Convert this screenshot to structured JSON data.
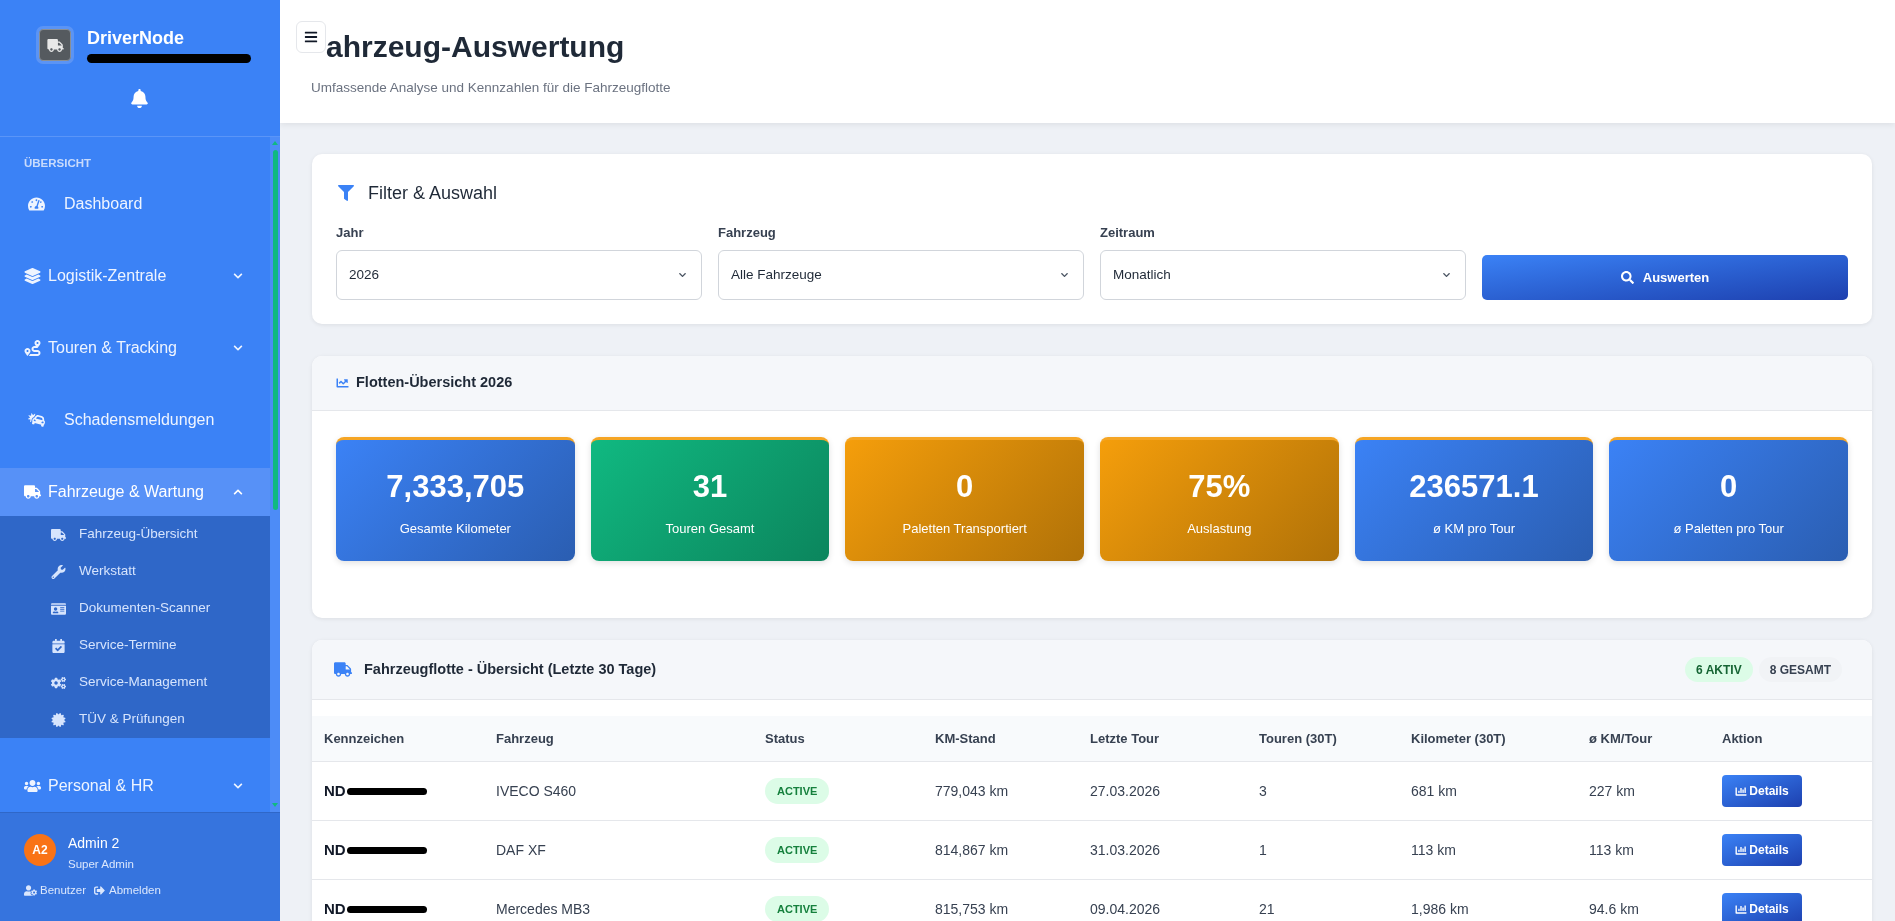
{
  "sidebar": {
    "brand": {
      "name": "DriverNode",
      "redacted": true
    },
    "section_label": "ÜBERSICHT",
    "items": [
      {
        "label": "Dashboard",
        "kind": "link",
        "selected": false
      },
      {
        "label": "Logistik-Zentrale",
        "kind": "group",
        "selected": false,
        "expanded": false
      },
      {
        "label": "Touren & Tracking",
        "kind": "group",
        "selected": false,
        "expanded": false
      },
      {
        "label": "Schadensmeldungen",
        "kind": "link",
        "selected": false
      },
      {
        "label": "Fahrzeuge & Wartung",
        "kind": "group",
        "selected": true,
        "expanded": true,
        "children": [
          {
            "label": "Fahrzeug-Übersicht",
            "selected": false
          },
          {
            "label": "Werkstatt",
            "selected": false
          },
          {
            "label": "Dokumenten-Scanner",
            "selected": false
          },
          {
            "label": "Service-Termine",
            "selected": false
          },
          {
            "label": "Service-Management",
            "selected": false
          },
          {
            "label": "TÜV & Prüfungen",
            "selected": false
          }
        ]
      },
      {
        "label": "Personal & HR",
        "kind": "group",
        "selected": false,
        "expanded": false
      }
    ],
    "user": {
      "initials": "A2",
      "name": "Admin 2",
      "role": "Super Admin",
      "links": [
        "Benutzer",
        "Abmelden"
      ]
    }
  },
  "header": {
    "title": "ahrzeug-Auswertung",
    "subtitle": "Umfassende Analyse und Kennzahlen für die Fahrzeugflotte"
  },
  "filter": {
    "title": "Filter & Auswahl",
    "fields": [
      {
        "label": "Jahr",
        "value": "2026"
      },
      {
        "label": "Fahrzeug",
        "value": "Alle Fahrzeuge"
      },
      {
        "label": "Zeitraum",
        "value": "Monatlich"
      }
    ],
    "button": "Auswerten"
  },
  "overview": {
    "title": "Flotten-Übersicht 2026",
    "stats": [
      {
        "value": "7,333,705",
        "label": "Gesamte Kilometer",
        "color": "#3b82f6"
      },
      {
        "value": "31",
        "label": "Touren Gesamt",
        "color": "#10b981"
      },
      {
        "value": "0",
        "label": "Paletten Transportiert",
        "color": "#f59e0b"
      },
      {
        "value": "75%",
        "label": "Auslastung",
        "color": "#f59e0b"
      },
      {
        "value": "236571.1",
        "label": "ø KM pro Tour",
        "color": "#3b82f6"
      },
      {
        "value": "0",
        "label": "ø Paletten pro Tour",
        "color": "#3b82f6"
      }
    ]
  },
  "fleet": {
    "title": "Fahrzeugflotte - Übersicht (Letzte 30 Tage)",
    "badges": [
      {
        "text": "6 AKTIV",
        "kind": "active"
      },
      {
        "text": "8 GESAMT",
        "kind": "total"
      }
    ],
    "columns": [
      "Kennzeichen",
      "Fahrzeug",
      "Status",
      "KM-Stand",
      "Letzte Tour",
      "Touren (30T)",
      "Kilometer (30T)",
      "ø KM/Tour",
      "Aktion"
    ],
    "rows": [
      {
        "plate": "ND",
        "redacted": true,
        "vehicle": "IVECO S460",
        "status": "ACTIVE",
        "km_stand": "779,043 km",
        "last_tour": "27.03.2026",
        "tours_30d": "3",
        "km_30d": "681 km",
        "km_per_tour": "227 km",
        "action": "Details"
      },
      {
        "plate": "ND",
        "redacted": true,
        "vehicle": "DAF XF",
        "status": "ACTIVE",
        "km_stand": "814,867 km",
        "last_tour": "31.03.2026",
        "tours_30d": "1",
        "km_30d": "113 km",
        "km_per_tour": "113 km",
        "action": "Details"
      },
      {
        "plate": "ND",
        "redacted": true,
        "vehicle": "Mercedes MB3",
        "status": "ACTIVE",
        "km_stand": "815,753 km",
        "last_tour": "09.04.2026",
        "tours_30d": "21",
        "km_30d": "1,986 km",
        "km_per_tour": "94.6 km",
        "action": "Details"
      }
    ]
  }
}
